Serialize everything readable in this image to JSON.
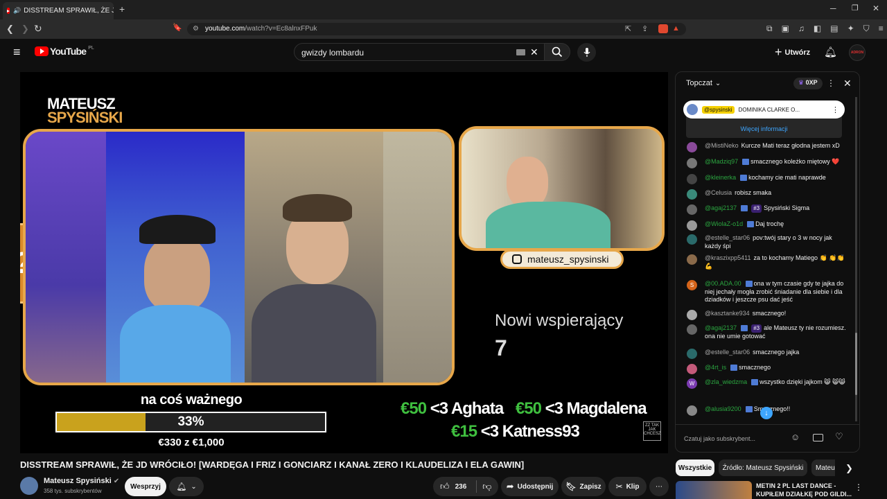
{
  "browser": {
    "tab_title": "DISSTREAM SPRAWIŁ, ŻE JD W",
    "url_domain": "youtube.com",
    "url_path": "/watch?v=Ec8alnxFPuk"
  },
  "header": {
    "logo": "YouTube",
    "region": "PL",
    "search_value": "gwizdy lombardu",
    "create_label": "Utwórz",
    "account_label": "ADRON"
  },
  "video": {
    "brand_line1": "MATEUSZ",
    "brand_line2": "SPYSIŃSKI",
    "instagram": "mateusz_spysinski",
    "supporters_label": "Nowi wspierający",
    "supporters_count": "7",
    "goal_label": "na coś ważnego",
    "goal_percent": "33%",
    "goal_fraction": 0.33,
    "goal_amount": "€330 z €1,000",
    "donations": [
      {
        "amount": "€50",
        "text": "<3 Aghata"
      },
      {
        "amount": "€50",
        "text": "<3 Magdalena"
      },
      {
        "amount": "€15",
        "text": "<3 Katness93"
      }
    ],
    "corner_logo": "ZZ TAK JAK CHCESZ",
    "colors": {
      "accent": "#e7a74a",
      "donation_green": "#3fbf3f",
      "goal_fill": "#c9a21d"
    }
  },
  "title": "DISSTREAM SPRAWIŁ, ŻE JD WRÓCIŁO! [WARDĘGA I FRIZ I GONCIARZ I KANAŁ ZERO I KLAUDELIZA I ELA GAWIN]",
  "channel": {
    "name": "Mateusz Spysiński",
    "subs": "358 tys. subskrybentów",
    "support_label": "Wesprzyj"
  },
  "actions": {
    "likes": "236",
    "share": "Udostępnij",
    "save": "Zapisz",
    "clip": "Klip"
  },
  "chat": {
    "header": "Topczat",
    "xp": "0XP",
    "pinned_user": "@spysinski",
    "pinned_text": "DOMINIKA CLARKE O...",
    "more_info": "Więcej informacji",
    "input_placeholder": "Czatuj jako subskrybent...",
    "messages": [
      {
        "user": "@MistiNeko",
        "text": "Kurcze Mati teraz głodna jestem xD",
        "green": false,
        "avatar": "#8a4a9a"
      },
      {
        "user": "@Madziq97",
        "text": "smacznego koleżko miętowy ❤️",
        "green": true,
        "avatar": "#777"
      },
      {
        "user": "@kleinerka",
        "text": "kochamy cie mati naprawde",
        "green": true,
        "avatar": "#444"
      },
      {
        "user": "@Celusia",
        "text": "robisz smaka",
        "green": false,
        "avatar": "#3a8a7a"
      },
      {
        "user": "@agaj2137",
        "text": "Spysiński Sigma",
        "green": true,
        "avatar": "#666",
        "pill": "#3"
      },
      {
        "user": "@WiolaZ-o1d",
        "text": "Daj trochę",
        "green": true,
        "avatar": "#999"
      },
      {
        "user": "@estelle_star06",
        "text": "pov:twój stary o 3 w nocy jak każdy śpi",
        "green": false,
        "avatar": "#2a6a6a"
      },
      {
        "user": "@kraszixpp5411",
        "text": "za to kochamy Matiego 👏 👏👏💪",
        "green": false,
        "avatar": "#8a6a4a"
      },
      {
        "user": "@00.ADA.00",
        "text": "ona w tym czasie gdy te jajka do niej jechały mogła zrobić śniadanie dla siebie i dla dziadków i jeszcze psu dać jeść",
        "green": true,
        "avatar": "#d4641a",
        "initial": "S"
      },
      {
        "user": "@kasztanke934",
        "text": "smacznego!",
        "green": false,
        "avatar": "#aaa"
      },
      {
        "user": "@agaj2137",
        "text": "ale Mateusz ty nie rozumiesz. ona nie umie gotować",
        "green": true,
        "avatar": "#666",
        "pill": "#3"
      },
      {
        "user": "@estelle_star06",
        "text": "smacznego jajka",
        "green": false,
        "avatar": "#2a6a6a"
      },
      {
        "user": "@4rt_is",
        "text": "smacznego",
        "green": true,
        "avatar": "#c45a7a"
      },
      {
        "user": "@zla_wiedzma",
        "text": "wszystko dzięki jajkom 😸 😸😸",
        "green": true,
        "avatar": "#7a3ab0",
        "initial": "W"
      },
      {
        "user": "@alusia9200",
        "text": "Smacznego!!",
        "green": true,
        "avatar": "#888"
      }
    ]
  },
  "chips": [
    "Wszystkie",
    "Źródło: Mateusz Spysiński",
    "Mateu"
  ],
  "recommended": {
    "title_line1": "METIN 2 PL LAST DANCE -",
    "title_line2": "KUPIŁEM DZIAŁKĘ POD GILDI..."
  }
}
